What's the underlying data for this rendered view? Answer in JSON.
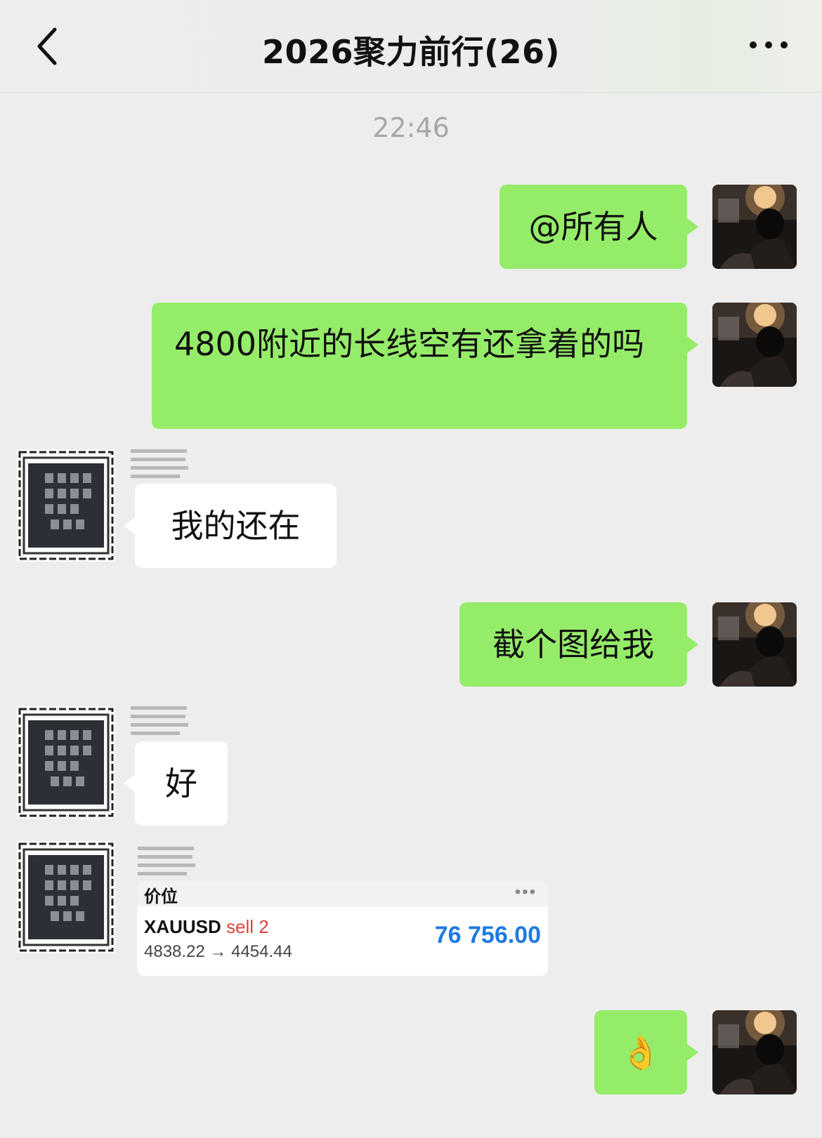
{
  "header": {
    "back_icon": "chevron-left-icon",
    "title": "2026聚力前行(26)",
    "more_icon": "more-dots-icon"
  },
  "timestamp": "22:46",
  "messages": [
    {
      "from": "me",
      "text": "@所有人"
    },
    {
      "from": "me",
      "text": "4800附近的长线空有还拿着的吗"
    },
    {
      "from": "other",
      "text": "我的还在"
    },
    {
      "from": "me",
      "text": "截个图给我"
    },
    {
      "from": "other",
      "text": "好"
    },
    {
      "from": "other",
      "type": "trade-card",
      "card": {
        "title": "价位",
        "symbol": "XAUUSD",
        "side": "sell 2",
        "price_range": "4838.22 → 4454.44",
        "profit": "76 756.00"
      }
    },
    {
      "from": "me",
      "text": "👌"
    }
  ],
  "colors": {
    "background": "#ededed",
    "my_bubble": "#95ec69",
    "their_bubble": "#ffffff",
    "sell": "#e0433a",
    "profit": "#1f7ae0"
  }
}
